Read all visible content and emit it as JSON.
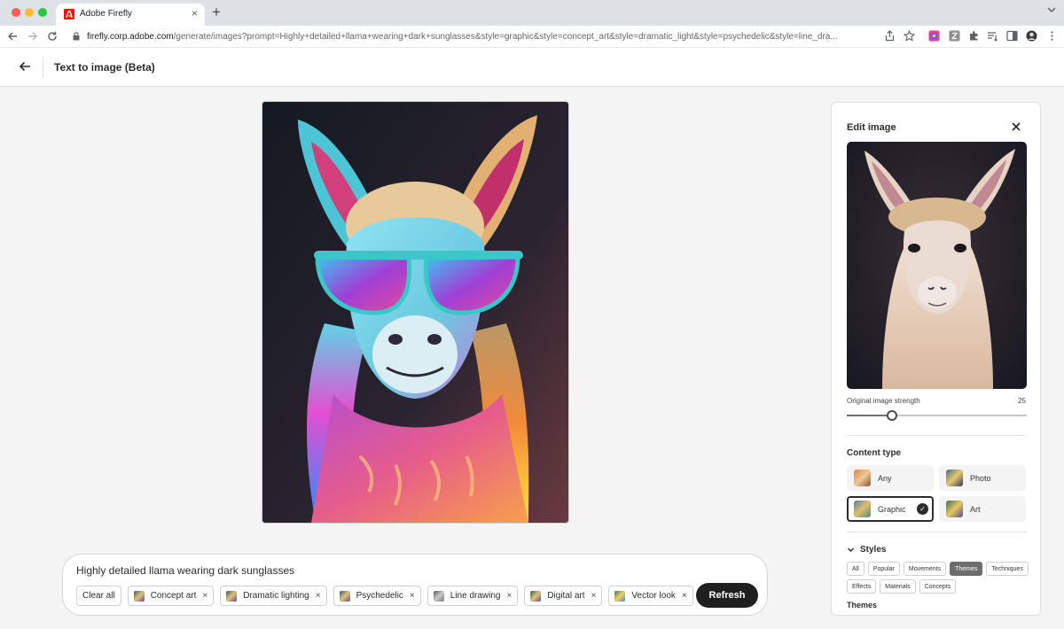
{
  "browser": {
    "tab_title": "Adobe Firefly",
    "new_tab": "+",
    "close_tab": "×",
    "url_host": "firefly.corp.adobe.com",
    "url_path": "/generate/images?prompt=Highly+detailed+llama+wearing+dark+sunglasses&style=graphic&style=concept_art&style=dramatic_light&style=psychedelic&style=line_dra..."
  },
  "header": {
    "title": "Text to image (Beta)"
  },
  "prompt": {
    "text": "Highly detailed llama wearing dark sunglasses",
    "clear_all": "Clear all",
    "chips": [
      {
        "label": "Concept art",
        "remove": "×"
      },
      {
        "label": "Dramatic lighting",
        "remove": "×"
      },
      {
        "label": "Psychedelic",
        "remove": "×"
      },
      {
        "label": "Line drawing",
        "remove": "×"
      },
      {
        "label": "Digital art",
        "remove": "×"
      },
      {
        "label": "Vector look",
        "remove": "×"
      }
    ],
    "refresh": "Refresh"
  },
  "edit_panel": {
    "title": "Edit image",
    "strength_label": "Original image strength",
    "strength_value": "25",
    "strength_fraction": 0.25,
    "content_type_title": "Content type",
    "content_types": [
      {
        "label": "Any",
        "selected": false
      },
      {
        "label": "Photo",
        "selected": false
      },
      {
        "label": "Graphic",
        "selected": true
      },
      {
        "label": "Art",
        "selected": false
      }
    ],
    "styles_title": "Styles",
    "style_filters": [
      {
        "label": "All",
        "active": false
      },
      {
        "label": "Popular",
        "active": false
      },
      {
        "label": "Movements",
        "active": false
      },
      {
        "label": "Themes",
        "active": true
      },
      {
        "label": "Techniques",
        "active": false
      },
      {
        "label": "Effects",
        "active": false
      },
      {
        "label": "Materials",
        "active": false
      },
      {
        "label": "Concepts",
        "active": false
      }
    ],
    "themes_title": "Themes"
  },
  "colors": {
    "accent_dark": "#1f1f1f",
    "active_filter": "#6d6d6d"
  }
}
